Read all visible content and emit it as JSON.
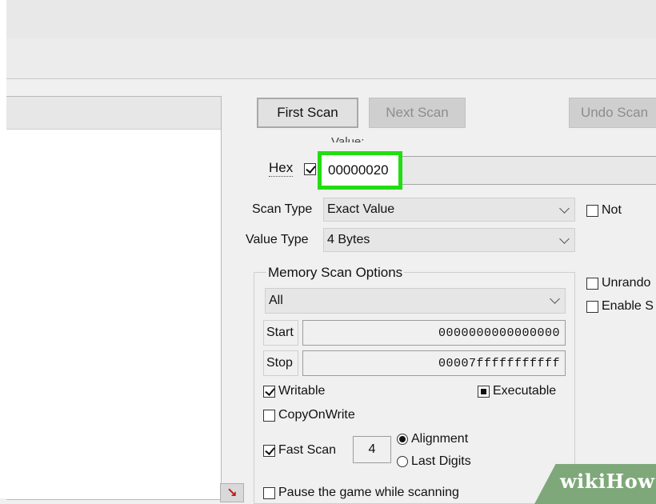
{
  "toolbar": {
    "first_scan": "First Scan",
    "next_scan": "Next Scan",
    "undo_scan": "Undo Scan"
  },
  "value": {
    "label": "Value:",
    "hex_label": "Hex",
    "hex_checked": true,
    "input_value": "00000020",
    "highlight_color": "#22dd11"
  },
  "scan_type": {
    "label": "Scan Type",
    "selected": "Exact Value",
    "not_label": "Not"
  },
  "value_type": {
    "label": "Value Type",
    "selected": "4 Bytes"
  },
  "memory_scan_options": {
    "title": "Memory Scan Options",
    "region": "All",
    "start_label": "Start",
    "start_value": "0000000000000000",
    "stop_label": "Stop",
    "stop_value": "00007fffffffffff",
    "writable_label": "Writable",
    "executable_label": "Executable",
    "copyonwrite_label": "CopyOnWrite",
    "fast_scan_label": "Fast Scan",
    "fast_scan_value": "4",
    "alignment_label": "Alignment",
    "last_digits_label": "Last Digits"
  },
  "side_options": {
    "unrandomizer": "Unrando",
    "enable": "Enable S"
  },
  "pause_label": "Pause the game while scanning",
  "watermark": {
    "part1": "wiki",
    "part2": "How"
  },
  "icons": {
    "arrow": "red-arrow-icon"
  }
}
